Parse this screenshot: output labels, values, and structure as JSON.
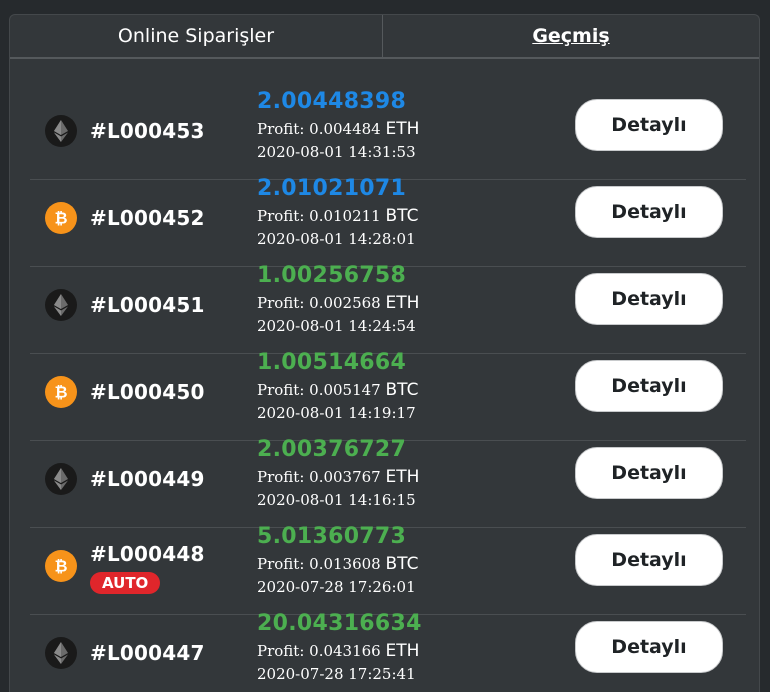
{
  "tabs": {
    "online_label": "Online Siparişler",
    "history_label": "Geçmiş"
  },
  "detail_label": "Detaylı",
  "colors": {
    "blue_amount": "#1e88e5",
    "green_amount": "#4caf50",
    "auto_badge": "#e0262b",
    "btc": "#f7931a"
  },
  "orders": [
    {
      "id": "#L000453",
      "coin": "eth-icon",
      "amount": "2.00448398",
      "amount_color": "blue",
      "profit_label": "Profit: 0.004484",
      "currency": "ETH",
      "date": "2020-08-01 14:31:53"
    },
    {
      "id": "#L000452",
      "coin": "btc-icon",
      "amount": "2.01021071",
      "amount_color": "blue",
      "profit_label": "Profit: 0.010211",
      "currency": "BTC",
      "date": "2020-08-01 14:28:01"
    },
    {
      "id": "#L000451",
      "coin": "eth-icon",
      "amount": "1.00256758",
      "amount_color": "green",
      "profit_label": "Profit: 0.002568",
      "currency": "ETH",
      "date": "2020-08-01 14:24:54"
    },
    {
      "id": "#L000450",
      "coin": "btc-icon",
      "amount": "1.00514664",
      "amount_color": "green",
      "profit_label": "Profit: 0.005147",
      "currency": "BTC",
      "date": "2020-08-01 14:19:17"
    },
    {
      "id": "#L000449",
      "coin": "eth-icon",
      "amount": "2.00376727",
      "amount_color": "green",
      "profit_label": "Profit: 0.003767",
      "currency": "ETH",
      "date": "2020-08-01 14:16:15"
    },
    {
      "id": "#L000448",
      "coin": "btc-icon",
      "amount": "5.01360773",
      "amount_color": "green",
      "profit_label": "Profit: 0.013608",
      "currency": "BTC",
      "date": "2020-07-28 17:26:01",
      "badge": "AUTO"
    },
    {
      "id": "#L000447",
      "coin": "eth-icon",
      "amount": "20.04316634",
      "amount_color": "green",
      "profit_label": "Profit: 0.043166",
      "currency": "ETH",
      "date": "2020-07-28 17:25:41"
    }
  ]
}
